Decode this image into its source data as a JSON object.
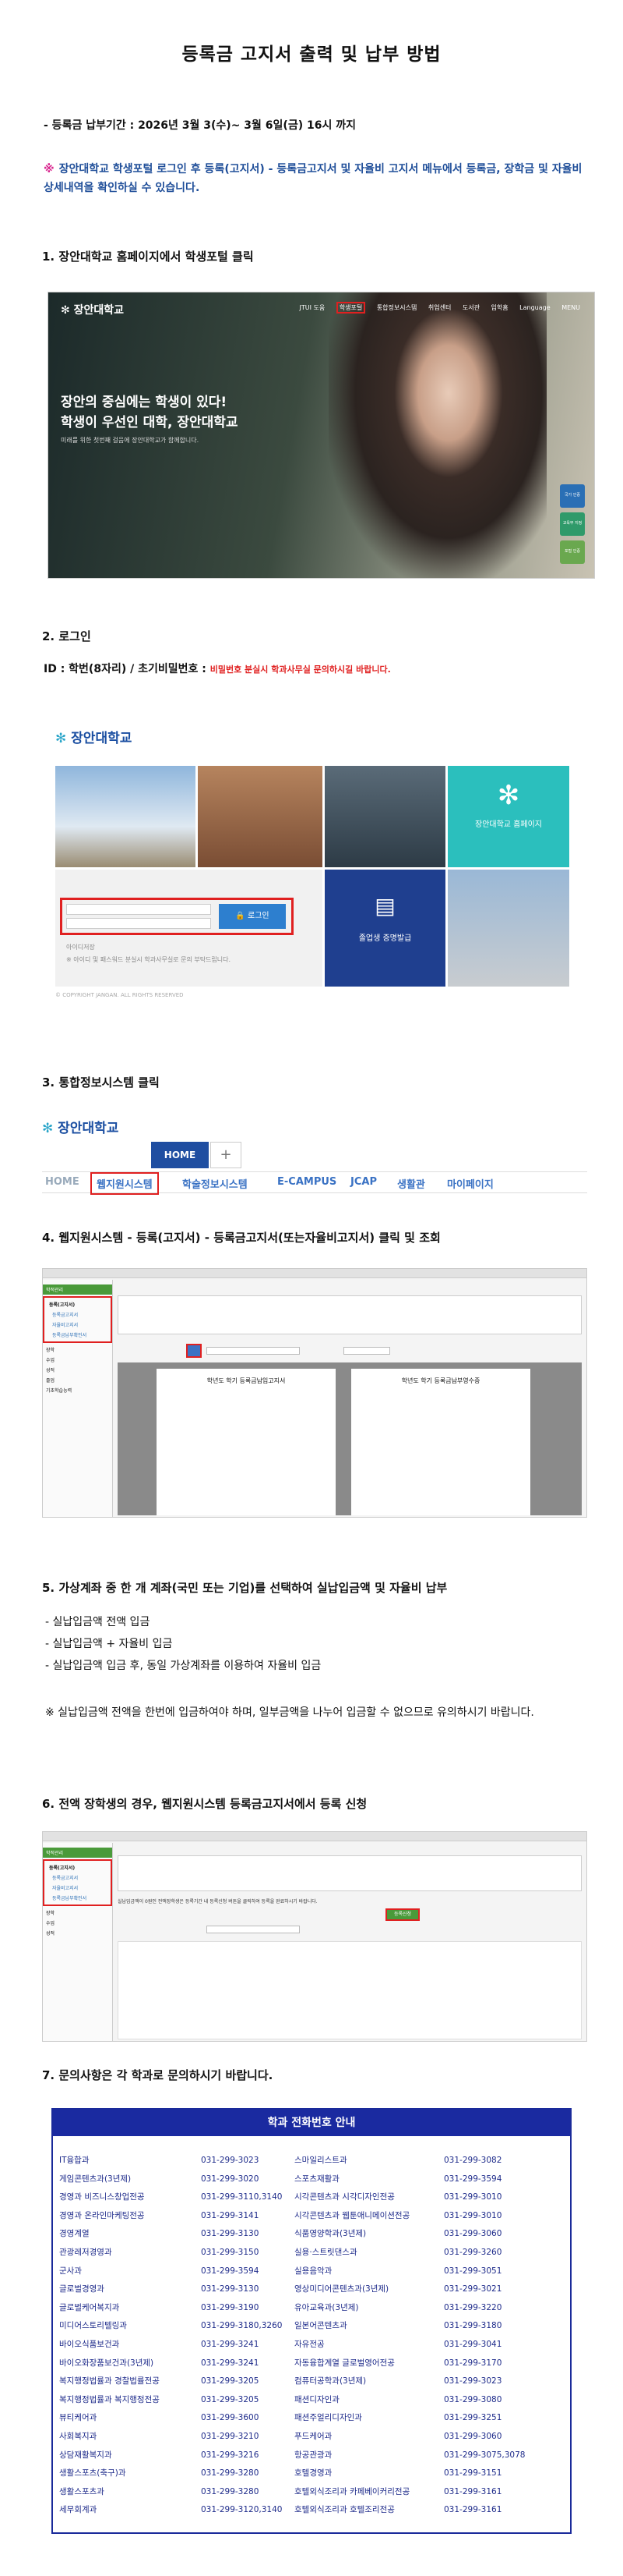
{
  "title": "등록금 고지서 출력 및 납부 방법",
  "period": "- 등록금 납부기간 : 2026년 3월 3(수)~ 3월 6일(금) 16시 까지",
  "notice": {
    "mark": "※",
    "text": "장안대학교 학생포털 로그인 후 등록(고지서) - 등록금고지서 및 자율비 고지서 메뉴에서 등록금, 장학금 및 자율비 상세내역을 확인하실 수 있습니다."
  },
  "steps": {
    "s1": "1. 장안대학교 홈페이지에서 학생포털 클릭",
    "s2": "2. 로그인",
    "s3": "3. 통합정보시스템  클릭",
    "s4": "4. 웹지원시스템 - 등록(고지서) - 등록금고지서(또는자율비고지서) 클릭 및 조회",
    "s5": "5. 가상계좌 중 한 개 계좌(국민 또는 기업)를 선택하여 실납입금액 및 자율비 납부",
    "s6": "6. 전액 장학생의 경우, 웹지원시스템 등록금고지서에서 등록 신청",
    "s7": "7. 문의사항은 각 학과로 문의하시기 바랍니다."
  },
  "login_info": {
    "label": "ID : 학번(8자리) / 초기비밀번호 :",
    "note": "비밀번호 분실시 학과사무실 문의하시길 바랍니다."
  },
  "hero": {
    "logo": "장안대학교",
    "nav": [
      "JTUI 도움",
      "학생포털",
      "통합정보시스템",
      "취업센터",
      "도서관",
      "입학홈",
      "Language",
      "MENU"
    ],
    "headline_1": "장안의 중심에는 학생이 있다!",
    "headline_2": "학생이 우선인 대학, 장안대학교",
    "sub": "미래를 위한 첫번째 걸음에 장안대학교가 함께합니다.",
    "badges": [
      "국가 인증",
      "교육부 지정",
      "포털 인증"
    ]
  },
  "login_page": {
    "logo": "장안대학교",
    "homepage_tile": "장안대학교 홈페이지",
    "login_button": "로그인",
    "cert_tile": "졸업생 증명발급",
    "save_id": "아이디저장",
    "hint": "※ 아이디 및 패스워드 분실시 학과사무실로 문의 부탁드립니다.",
    "copyright": "© COPYRIGHT JANGAN. ALL RIGHTS RESERVED"
  },
  "intranet": {
    "logo": "장안대학교",
    "home_tab": "HOME",
    "plus_tab": "+",
    "menu": [
      "HOME",
      "웹지원시스템",
      "학술정보시스템",
      "E-CAMPUS",
      "JCAP",
      "생활관",
      "마이페이지"
    ]
  },
  "websys": {
    "sidebar": [
      "학적관리",
      "등록(고지서)",
      "등록금고지서",
      "자율비고지서",
      "등록금납부확인서",
      "장학",
      "수업",
      "성적",
      "졸업",
      "기초학습능력"
    ],
    "doc_title": "학년도 학기 등록금납입고지서",
    "doc_title_2": "학년도 학기 등록금납부영수증"
  },
  "step5_lines": [
    "- 실납입금액 전액 입금",
    "- 실납입금액 + 자율비 입금",
    "- 실납입금액 입금 후, 동일 가상계좌를 이용하여 자율비 입금"
  ],
  "step5_note": "※ 실납입금액 전액을 한번에 입금하여야 하며, 일부금액을 나누어 입금할 수 없으므로 유의하시기 바랍니다.",
  "websys2": {
    "register_button": "등록신청",
    "notice": "실납입금액이 0원인 전액장학생은 등록기간 내 등록신청 버튼을 클릭하여 등록을 완료하시기 바랍니다."
  },
  "table": {
    "title": "학과 전화번호 안내",
    "rows": [
      [
        "IT융합과",
        "031-299-3023",
        "스마일리스트과",
        "031-299-3082"
      ],
      [
        "게임콘텐츠과(3년제)",
        "031-299-3020",
        "스포츠재활과",
        "031-299-3594"
      ],
      [
        "경영과 비즈니스창업전공",
        "031-299-3110,3140",
        "시각콘텐츠과 시각디자인전공",
        "031-299-3010"
      ],
      [
        "경영과 온라인마케팅전공",
        "031-299-3141",
        "시각콘텐츠과 웹툰애니메이션전공",
        "031-299-3010"
      ],
      [
        "경영계열",
        "031-299-3130",
        "식품영양학과(3년제)",
        "031-299-3060"
      ],
      [
        "관광레저경영과",
        "031-299-3150",
        "실용·스트릿댄스과",
        "031-299-3260"
      ],
      [
        "군사과",
        "031-299-3594",
        "실용음악과",
        "031-299-3051"
      ],
      [
        "글로벌경영과",
        "031-299-3130",
        "영상미디어콘텐츠과(3년제)",
        "031-299-3021"
      ],
      [
        "글로벌케어복지과",
        "031-299-3190",
        "유아교육과(3년제)",
        "031-299-3220"
      ],
      [
        "미디어스토리텔링과",
        "031-299-3180,3260",
        "일본어콘텐츠과",
        "031-299-3180"
      ],
      [
        "바이오식품보건과",
        "031-299-3241",
        "자유전공",
        "031-299-3041"
      ],
      [
        "바이오화장품보건과(3년제)",
        "031-299-3241",
        "자동융합계열 글로벌영어전공",
        "031-299-3170"
      ],
      [
        "복지행정법률과 경찰법률전공",
        "031-299-3205",
        "컴퓨터공학과(3년제)",
        "031-299-3023"
      ],
      [
        "복지행정법률과 복지행정전공",
        "031-299-3205",
        "패션디자인과",
        "031-299-3080"
      ],
      [
        "뷰티케어과",
        "031-299-3600",
        "패션주얼리디자인과",
        "031-299-3251"
      ],
      [
        "사회복지과",
        "031-299-3210",
        "푸드케어과",
        "031-299-3060"
      ],
      [
        "상담재활복지과",
        "031-299-3216",
        "항공관광과",
        "031-299-3075,3078"
      ],
      [
        "생활스포츠(축구)과",
        "031-299-3280",
        "호텔경영과",
        "031-299-3151"
      ],
      [
        "생활스포츠과",
        "031-299-3280",
        "호텔외식조리과 카페베이커리전공",
        "031-299-3161"
      ],
      [
        "세무회계과",
        "031-299-3120,3140",
        "호텔외식조리과 호텔조리전공",
        "031-299-3161"
      ]
    ]
  },
  "colors": {
    "accent_blue": "#1f4e99",
    "highlight_red": "#e02020",
    "notice_mark": "#d9268f",
    "table_header": "#1a2aa0",
    "table_text": "#1d2a8a"
  }
}
